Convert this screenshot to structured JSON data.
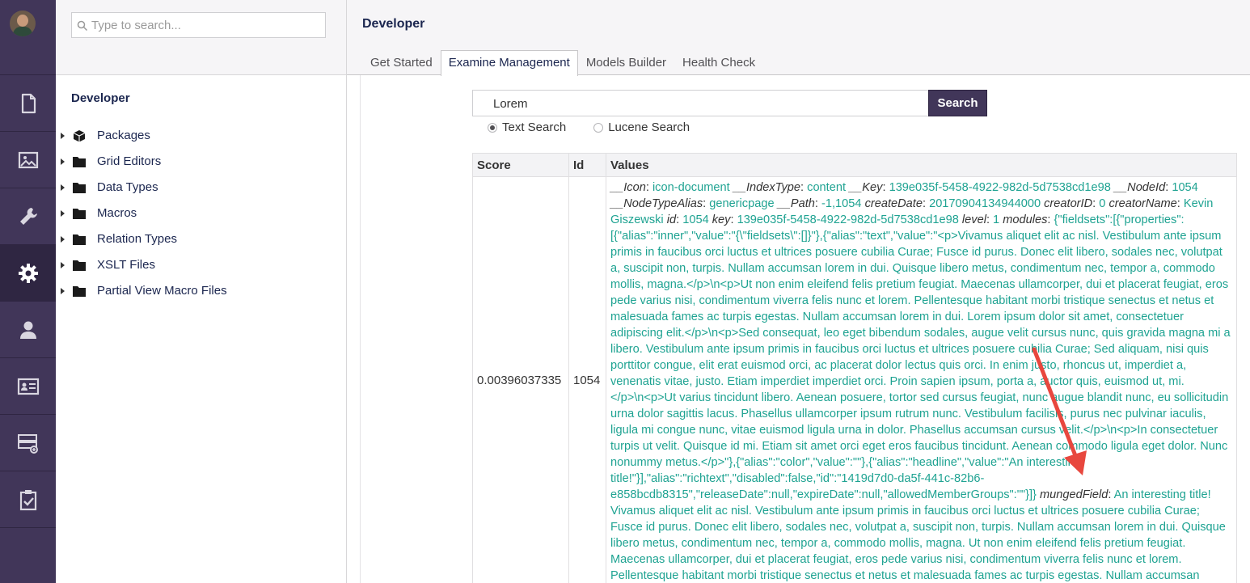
{
  "rail": {
    "icons": [
      "content-icon",
      "media-icon",
      "settings-wrench-icon",
      "developer-gear-icon",
      "users-icon",
      "members-icon",
      "forms-icon",
      "translation-icon"
    ]
  },
  "tree": {
    "search_placeholder": "Type to search...",
    "title": "Developer",
    "items": [
      {
        "label": "Packages",
        "icon": "package-icon"
      },
      {
        "label": "Grid Editors",
        "icon": "folder-icon"
      },
      {
        "label": "Data Types",
        "icon": "folder-icon"
      },
      {
        "label": "Macros",
        "icon": "folder-icon"
      },
      {
        "label": "Relation Types",
        "icon": "folder-icon"
      },
      {
        "label": "XSLT Files",
        "icon": "folder-icon"
      },
      {
        "label": "Partial View Macro Files",
        "icon": "folder-icon"
      }
    ]
  },
  "main": {
    "title": "Developer",
    "tabs": [
      "Get Started",
      "Examine Management",
      "Models Builder",
      "Health Check"
    ],
    "active_tab": "Examine Management",
    "search": {
      "value": "Lorem",
      "button": "Search"
    },
    "modes": [
      "Text Search",
      "Lucene Search"
    ],
    "selected_mode": "Text Search",
    "results": {
      "headers": [
        "Score",
        "Id",
        "Values"
      ],
      "rows": [
        {
          "score": "0.00396037335",
          "id": "1054",
          "values": [
            {
              "k": "__Icon",
              "v": "icon-document"
            },
            {
              "k": "__IndexType",
              "v": "content"
            },
            {
              "k": "__Key",
              "v": "139e035f-5458-4922-982d-5d7538cd1e98"
            },
            {
              "k": "__NodeId",
              "v": "1054"
            },
            {
              "k": "__NodeTypeAlias",
              "v": "genericpage"
            },
            {
              "k": "__Path",
              "v": "-1,1054"
            },
            {
              "k": "createDate",
              "v": "20170904134944000"
            },
            {
              "k": "creatorID",
              "v": "0"
            },
            {
              "k": "creatorName",
              "v": "Kevin Giszewski"
            },
            {
              "k": "id",
              "v": "1054"
            },
            {
              "k": "key",
              "v": "139e035f-5458-4922-982d-5d7538cd1e98"
            },
            {
              "k": "level",
              "v": "1"
            },
            {
              "k": "modules",
              "v": "{\"fieldsets\":[{\"properties\":[{\"alias\":\"inner\",\"value\":\"{\\\"fieldsets\\\":[]}\"},{\"alias\":\"text\",\"value\":\"<p>Vivamus aliquet elit ac nisl. Vestibulum ante ipsum primis in faucibus orci luctus et ultrices posuere cubilia Curae; Fusce id purus. Donec elit libero, sodales nec, volutpat a, suscipit non, turpis. Nullam accumsan lorem in dui. Quisque libero metus, condimentum nec, tempor a, commodo mollis, magna.</p>\\n<p>Ut non enim eleifend felis pretium feugiat. Maecenas ullamcorper, dui et placerat feugiat, eros pede varius nisi, condimentum viverra felis nunc et lorem. Pellentesque habitant morbi tristique senectus et netus et malesuada fames ac turpis egestas. Nullam accumsan lorem in dui. Lorem ipsum dolor sit amet, consectetuer adipiscing elit.</p>\\n<p>Sed consequat, leo eget bibendum sodales, augue velit cursus nunc, quis gravida magna mi a libero. Vestibulum ante ipsum primis in faucibus orci luctus et ultrices posuere cubilia Curae; Sed aliquam, nisi quis porttitor congue, elit erat euismod orci, ac placerat dolor lectus quis orci. In enim justo, rhoncus ut, imperdiet a, venenatis vitae, justo. Etiam imperdiet imperdiet orci. Proin sapien ipsum, porta a, auctor quis, euismod ut, mi.</p>\\n<p>Ut varius tincidunt libero. Aenean posuere, tortor sed cursus feugiat, nunc augue blandit nunc, eu sollicitudin urna dolor sagittis lacus. Phasellus ullamcorper ipsum rutrum nunc. Vestibulum facilisis, purus nec pulvinar iaculis, ligula mi congue nunc, vitae euismod ligula urna in dolor. Phasellus accumsan cursus velit.</p>\\n<p>In consectetuer turpis ut velit. Quisque id mi. Etiam sit amet orci eget eros faucibus tincidunt. Aenean commodo ligula eget dolor. Nunc nonummy metus.</p>\"},{\"alias\":\"color\",\"value\":\"\"},{\"alias\":\"headline\",\"value\":\"An interesting title!\"}],\"alias\":\"richtext\",\"disabled\":false,\"id\":\"1419d7d0-da5f-441c-82b6-e858bcdb8315\",\"releaseDate\":null,\"expireDate\":null,\"allowedMemberGroups\":\"\"}]}"
            },
            {
              "k": "mungedField",
              "v": "An interesting title! Vivamus aliquet elit ac nisl. Vestibulum ante ipsum primis in faucibus orci luctus et ultrices posuere cubilia Curae; Fusce id purus. Donec elit libero, sodales nec, volutpat a, suscipit non, turpis. Nullam accumsan lorem in dui. Quisque libero metus, condimentum nec, tempor a, commodo mollis, magna. Ut non enim eleifend felis pretium feugiat. Maecenas ullamcorper, dui et placerat feugiat, eros pede varius nisi, condimentum viverra felis nunc et lorem. Pellentesque habitant morbi tristique senectus et netus et malesuada fames ac turpis egestas. Nullam accumsan"
            }
          ]
        }
      ]
    }
  },
  "colors": {
    "rail": "#413659",
    "accent_text": "#1fa392",
    "annotation_arrow": "#e8473e"
  }
}
